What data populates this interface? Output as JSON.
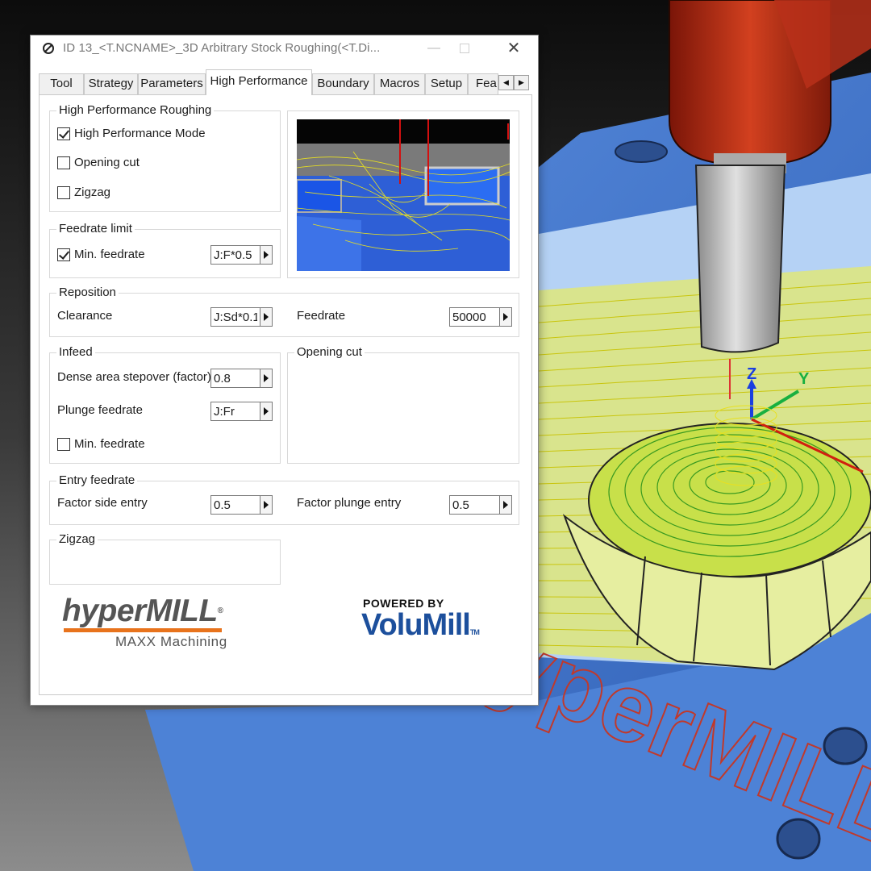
{
  "window": {
    "title": "ID 13_<T.NCNAME>_3D Arbitrary Stock Roughing(<T.Di...",
    "minimize": "—",
    "close": "✕"
  },
  "tabs": [
    {
      "label": "Tool",
      "active": false
    },
    {
      "label": "Strategy",
      "active": false
    },
    {
      "label": "Parameters",
      "active": false
    },
    {
      "label": "High Performance",
      "active": true
    },
    {
      "label": "Boundary",
      "active": false
    },
    {
      "label": "Macros",
      "active": false
    },
    {
      "label": "Setup",
      "active": false
    },
    {
      "label": "Fea",
      "active": false
    }
  ],
  "tab_scroll": {
    "left": "◀",
    "right": "▶"
  },
  "high_performance_roughing": {
    "label": "High Performance Roughing",
    "high_performance_mode": {
      "label": "High Performance Mode",
      "checked": true
    },
    "opening_cut": {
      "label": "Opening cut",
      "checked": false
    },
    "zigzag": {
      "label": "Zigzag",
      "checked": false
    }
  },
  "feedrate_limit": {
    "label": "Feedrate limit",
    "min_feedrate": {
      "label": "Min. feedrate",
      "checked": true,
      "value": "J:F*0.5"
    }
  },
  "reposition": {
    "label": "Reposition",
    "clearance": {
      "label": "Clearance",
      "value": "J:Sd*0.1"
    },
    "feedrate": {
      "label": "Feedrate",
      "value": "50000"
    }
  },
  "infeed": {
    "label": "Infeed",
    "dense_area_stepover": {
      "label": "Dense area stepover (factor)",
      "value": "0.8"
    },
    "plunge_feedrate": {
      "label": "Plunge feedrate",
      "value": "J:Fr"
    },
    "min_feedrate": {
      "label": "Min. feedrate",
      "checked": false
    }
  },
  "opening_cut_group": {
    "label": "Opening cut"
  },
  "entry_feedrate": {
    "label": "Entry feedrate",
    "factor_side_entry": {
      "label": "Factor side entry",
      "value": "0.5"
    },
    "factor_plunge_entry": {
      "label": "Factor plunge entry",
      "value": "0.5"
    }
  },
  "zigzag_group": {
    "label": "Zigzag"
  },
  "logos": {
    "hypermill": {
      "word": "hyperMILL",
      "reg": "®",
      "sub": "MAXX Machining"
    },
    "volumill": {
      "powered_by": "POWERED BY",
      "word": "VoluMill",
      "tm": "TM"
    }
  },
  "scene": {
    "axis_labels": {
      "z": "Z",
      "y": "Y"
    },
    "watermark": "hyperMILL",
    "colors": {
      "part": "#4a7fd0",
      "toolpath": "#e8e82a",
      "spindle": "#c0301a",
      "tool": "#a8a8a8"
    }
  }
}
